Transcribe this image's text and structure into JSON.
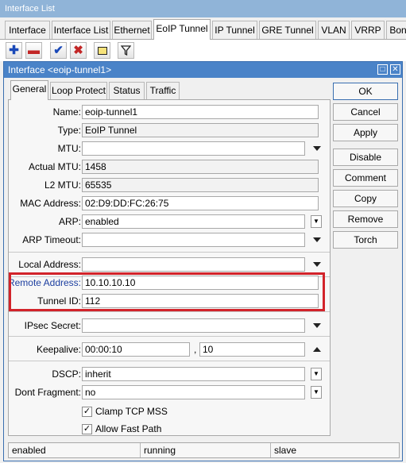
{
  "window": {
    "title": "Interface List"
  },
  "tabs": [
    "Interface",
    "Interface List",
    "Ethernet",
    "EoIP Tunnel",
    "IP Tunnel",
    "GRE Tunnel",
    "VLAN",
    "VRRP",
    "Bon"
  ],
  "toolbar": {
    "icons": [
      "plus-icon",
      "minus-icon",
      "check-icon",
      "x-icon",
      "note-icon",
      "filter-icon"
    ]
  },
  "dialog": {
    "title": "Interface <eoip-tunnel1>",
    "tabs": [
      "General",
      "Loop Protect",
      "Status",
      "Traffic"
    ],
    "fields": {
      "name": {
        "label": "Name:",
        "value": "eoip-tunnel1"
      },
      "type": {
        "label": "Type:",
        "value": "EoIP Tunnel"
      },
      "mtu": {
        "label": "MTU:",
        "value": ""
      },
      "actual_mtu": {
        "label": "Actual MTU:",
        "value": "1458"
      },
      "l2_mtu": {
        "label": "L2 MTU:",
        "value": "65535"
      },
      "mac_address": {
        "label": "MAC Address:",
        "value": "02:D9:DD:FC:26:75"
      },
      "arp": {
        "label": "ARP:",
        "value": "enabled"
      },
      "arp_timeout": {
        "label": "ARP Timeout:",
        "value": ""
      },
      "local_address": {
        "label": "Local Address:",
        "value": ""
      },
      "remote_address": {
        "label": "Remote Address:",
        "value": "10.10.10.10"
      },
      "tunnel_id": {
        "label": "Tunnel ID:",
        "value": "112"
      },
      "ipsec_secret": {
        "label": "IPsec Secret:",
        "value": ""
      },
      "keepalive": {
        "label": "Keepalive:",
        "value": "00:00:10",
        "sep": ",",
        "value2": "10"
      },
      "dscp": {
        "label": "DSCP:",
        "value": "inherit"
      },
      "dont_fragment": {
        "label": "Dont Fragment:",
        "value": "no"
      },
      "clamp_tcp_mss": {
        "label": "Clamp TCP MSS",
        "checked": true
      },
      "allow_fast_path": {
        "label": "Allow Fast Path",
        "checked": true
      }
    },
    "buttons": [
      "OK",
      "Cancel",
      "Apply",
      "Disable",
      "Comment",
      "Copy",
      "Remove",
      "Torch"
    ],
    "status": [
      "enabled",
      "running",
      "slave"
    ]
  },
  "colors": {
    "highlight": "#d2232a",
    "title_bar": "#4a83c8",
    "outer_title": "#90b4d8"
  }
}
